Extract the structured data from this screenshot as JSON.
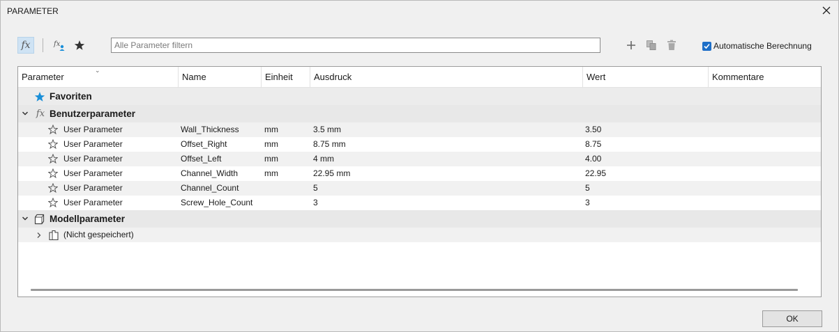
{
  "window": {
    "title": "PARAMETER"
  },
  "toolbar": {
    "filter_placeholder": "Alle Parameter filtern",
    "auto_calc_label": "Automatische Berechnung",
    "auto_calc_checked": true
  },
  "columns": [
    "Parameter",
    "Name",
    "Einheit",
    "Ausdruck",
    "Wert",
    "Kommentare"
  ],
  "groups": {
    "favorites": "Favoriten",
    "user": "Benutzerparameter",
    "model": "Modellparameter",
    "model_child": "(Nicht gespeichert)"
  },
  "rows": [
    {
      "param": "User Parameter",
      "name": "Wall_Thickness",
      "unit": "mm",
      "expr": "3.5 mm",
      "value": "3.50",
      "comment": ""
    },
    {
      "param": "User Parameter",
      "name": "Offset_Right",
      "unit": "mm",
      "expr": "8.75 mm",
      "value": "8.75",
      "comment": ""
    },
    {
      "param": "User Parameter",
      "name": "Offset_Left",
      "unit": "mm",
      "expr": "4 mm",
      "value": "4.00",
      "comment": ""
    },
    {
      "param": "User Parameter",
      "name": "Channel_Width",
      "unit": "mm",
      "expr": "22.95 mm",
      "value": "22.95",
      "comment": ""
    },
    {
      "param": "User Parameter",
      "name": "Channel_Count",
      "unit": "",
      "expr": "5",
      "value": "5",
      "comment": ""
    },
    {
      "param": "User Parameter",
      "name": "Screw_Hole_Count",
      "unit": "",
      "expr": "3",
      "value": "3",
      "comment": ""
    }
  ],
  "footer": {
    "ok_label": "OK"
  },
  "colors": {
    "accent": "#1e6fc8",
    "star_blue": "#1a8fd8",
    "fx_active_bg": "#cfe3f4"
  }
}
